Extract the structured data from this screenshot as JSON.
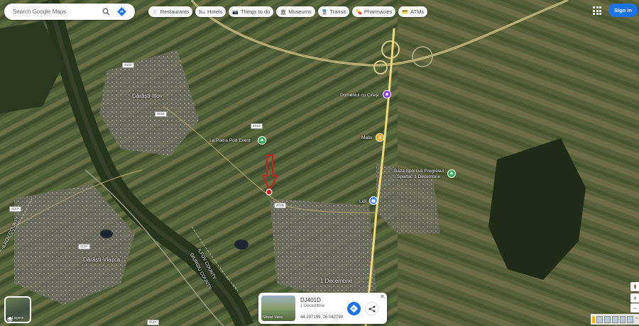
{
  "search": {
    "placeholder": "Search Google Maps"
  },
  "chips": [
    {
      "icon": "restaurant-icon",
      "glyph": "🍴",
      "label": "Restaurants"
    },
    {
      "icon": "hotel-icon",
      "glyph": "🛏",
      "label": "Hotels"
    },
    {
      "icon": "camera-icon",
      "glyph": "📷",
      "label": "Things to do"
    },
    {
      "icon": "museum-icon",
      "glyph": "🏛",
      "label": "Museums"
    },
    {
      "icon": "transit-icon",
      "glyph": "🚆",
      "label": "Transit"
    },
    {
      "icon": "pharmacy-icon",
      "glyph": "💊",
      "label": "Pharmacies"
    },
    {
      "icon": "atm-icon",
      "glyph": "💳",
      "label": "ATMs"
    }
  ],
  "header": {
    "signin_label": "Sign in"
  },
  "map_labels": {
    "darasti_ilfov": "Dărăști-Ilfov",
    "darasti_vlasca": "Dărăști-Vlașca",
    "decembrie": "1 Decembrie",
    "domeniul": "Domeniul cu Cireși",
    "matis": "Matis",
    "lidl": "Lidl",
    "baza_line1": "Baza Sportivă Progresul",
    "baza_line2": "Spartac 1 Decembrie",
    "la_piatra": "La Piatra Pod Event",
    "ilfov_county": "ILFOV COUNTY",
    "giurgiu_county": "GIURGIU COUNTY",
    "ilfov_county_left": "ILFOV COUNTY"
  },
  "road_shields": [
    "401D",
    "401D",
    "401D",
    "412A",
    "412A",
    "401D",
    "412A"
  ],
  "layers": {
    "label": "Layers"
  },
  "place_card": {
    "title": "DJ401D",
    "subtitle": "1 Decembrie",
    "coordinates": "44.297159, 26.042790",
    "street_view_label": "Street View",
    "close_glyph": "✕"
  },
  "zoom": {
    "in_glyph": "+",
    "out_glyph": "−"
  },
  "colors": {
    "accent": "#1a73e8",
    "marker": "#c5221f",
    "poi_green": "#34a853",
    "poi_purple": "#9334e6",
    "poi_orange": "#f29900",
    "poi_blue": "#4285f4"
  }
}
